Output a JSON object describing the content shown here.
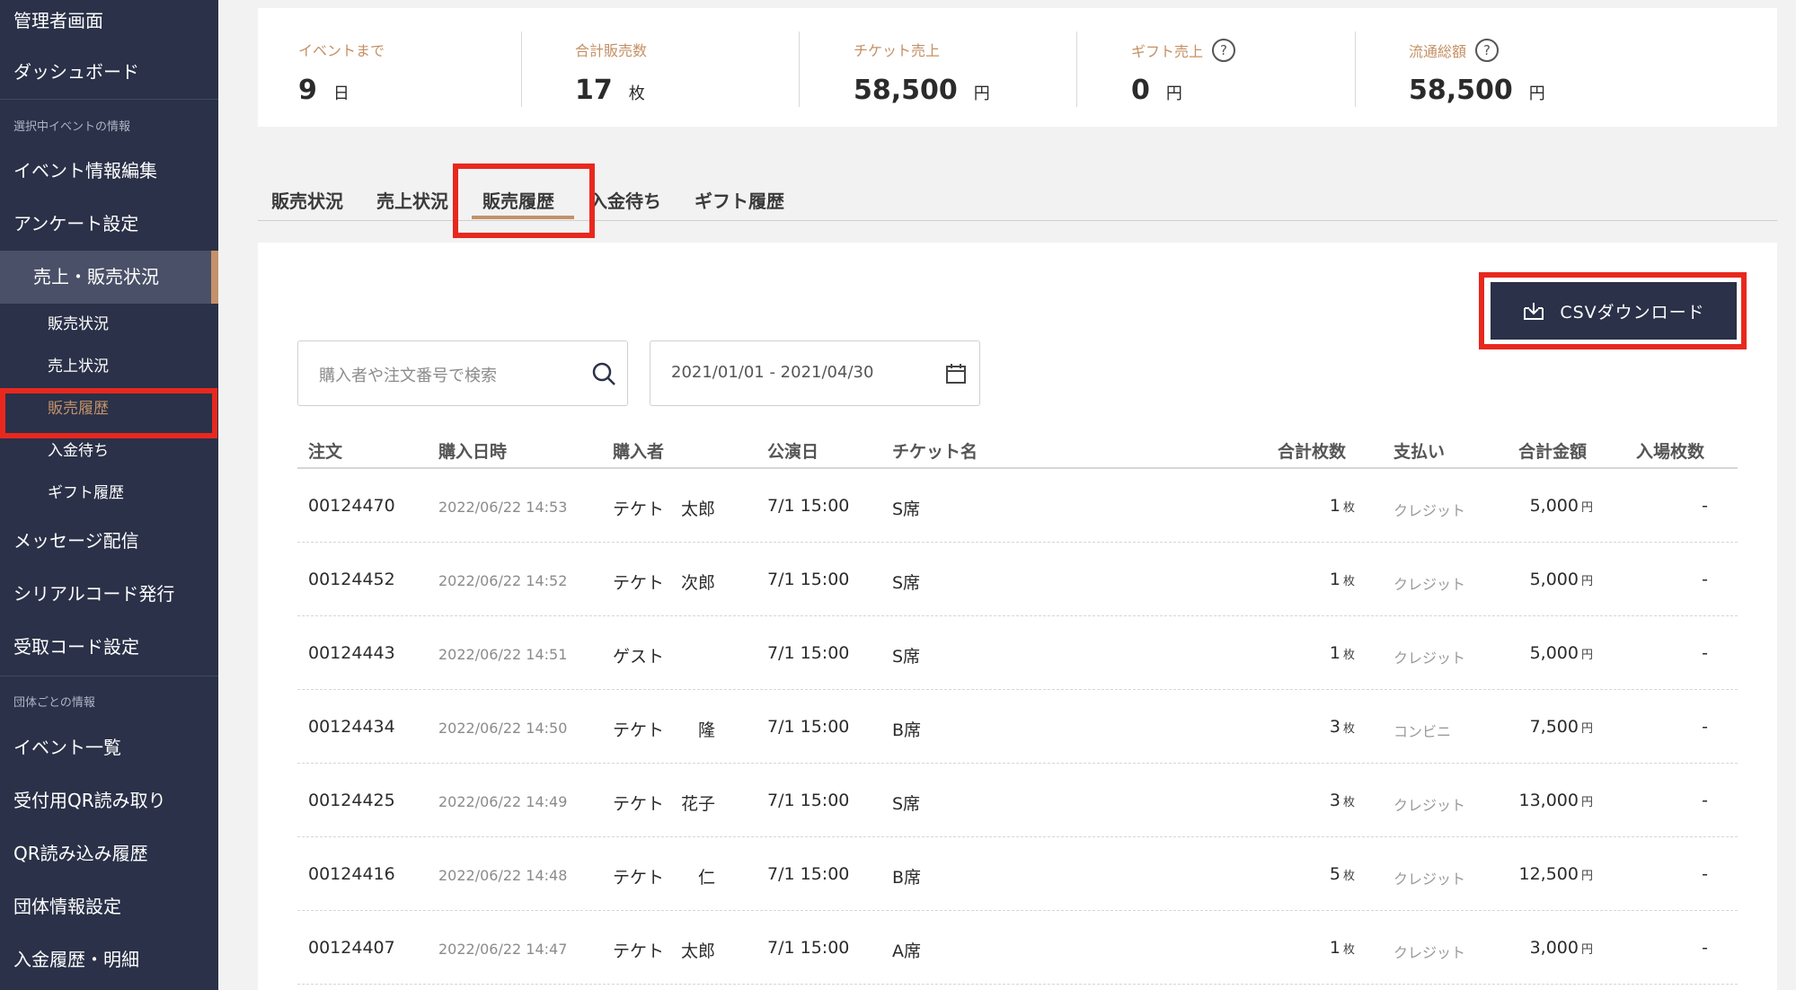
{
  "sidebar": {
    "admin": "管理者画面",
    "dashboard": "ダッシュボード",
    "section_event": "選択中イベントの情報",
    "event_edit": "イベント情報編集",
    "survey": "アンケート設定",
    "sales": "売上・販売状況",
    "sub": {
      "sales_status": "販売状況",
      "revenue_status": "売上状況",
      "sales_history": "販売履歴",
      "pending_payment": "入金待ち",
      "gift_history": "ギフト履歴"
    },
    "message": "メッセージ配信",
    "serial": "シリアルコード発行",
    "receive_code": "受取コード設定",
    "section_group": "団体ごとの情報",
    "event_list": "イベント一覧",
    "qr_reader": "受付用QR読み取り",
    "qr_history": "QR読み込み履歴",
    "group_settings": "団体情報設定",
    "payment_history": "入金履歴・明細"
  },
  "stats": [
    {
      "label": "イベントまで",
      "value": "9",
      "unit": "日"
    },
    {
      "label": "合計販売数",
      "value": "17",
      "unit": "枚"
    },
    {
      "label": "チケット売上",
      "value": "58,500",
      "unit": "円"
    },
    {
      "label": "ギフト売上",
      "value": "0",
      "unit": "円"
    },
    {
      "label": "流通総額",
      "value": "58,500",
      "unit": "円"
    }
  ],
  "tabs": [
    "販売状況",
    "売上状況",
    "販売履歴",
    "入金待ち",
    "ギフト履歴"
  ],
  "toolbar": {
    "csv_label": "CSVダウンロード",
    "search_placeholder": "購入者や注文番号で検索",
    "date_range": "2021/01/01 - 2021/04/30"
  },
  "table": {
    "headers": {
      "order": "注文",
      "purchased_at": "購入日時",
      "buyer": "購入者",
      "show_date": "公演日",
      "ticket": "チケット名",
      "qty": "合計枚数",
      "payment": "支払い",
      "total": "合計金額",
      "entered": "入場枚数"
    },
    "qty_unit": "枚",
    "yen_unit": "円",
    "rows": [
      {
        "order": "00124470",
        "date": "2022/06/22 14:53",
        "buyer": "テケト　太郎",
        "show": "7/1 15:00",
        "ticket": "S席",
        "qty": "1",
        "payment": "クレジット",
        "total": "5,000",
        "entered": "-"
      },
      {
        "order": "00124452",
        "date": "2022/06/22 14:52",
        "buyer": "テケト　次郎",
        "show": "7/1 15:00",
        "ticket": "S席",
        "qty": "1",
        "payment": "クレジット",
        "total": "5,000",
        "entered": "-"
      },
      {
        "order": "00124443",
        "date": "2022/06/22 14:51",
        "buyer": "ゲスト",
        "show": "7/1 15:00",
        "ticket": "S席",
        "qty": "1",
        "payment": "クレジット",
        "total": "5,000",
        "entered": "-"
      },
      {
        "order": "00124434",
        "date": "2022/06/22 14:50",
        "buyer": "テケト　　隆",
        "show": "7/1 15:00",
        "ticket": "B席",
        "qty": "3",
        "payment": "コンビニ",
        "total": "7,500",
        "entered": "-"
      },
      {
        "order": "00124425",
        "date": "2022/06/22 14:49",
        "buyer": "テケト　花子",
        "show": "7/1 15:00",
        "ticket": "S席",
        "qty": "3",
        "payment": "クレジット",
        "total": "13,000",
        "entered": "-"
      },
      {
        "order": "00124416",
        "date": "2022/06/22 14:48",
        "buyer": "テケト　　仁",
        "show": "7/1 15:00",
        "ticket": "B席",
        "qty": "5",
        "payment": "クレジット",
        "total": "12,500",
        "entered": "-"
      },
      {
        "order": "00124407",
        "date": "2022/06/22 14:47",
        "buyer": "テケト　太郎",
        "show": "7/1 15:00",
        "ticket": "A席",
        "qty": "1",
        "payment": "クレジット",
        "total": "3,000",
        "entered": "-"
      }
    ]
  },
  "colors": {
    "sidebar_bg": "#2a3148",
    "accent": "#c4916a",
    "highlight_red": "#e8281e"
  }
}
